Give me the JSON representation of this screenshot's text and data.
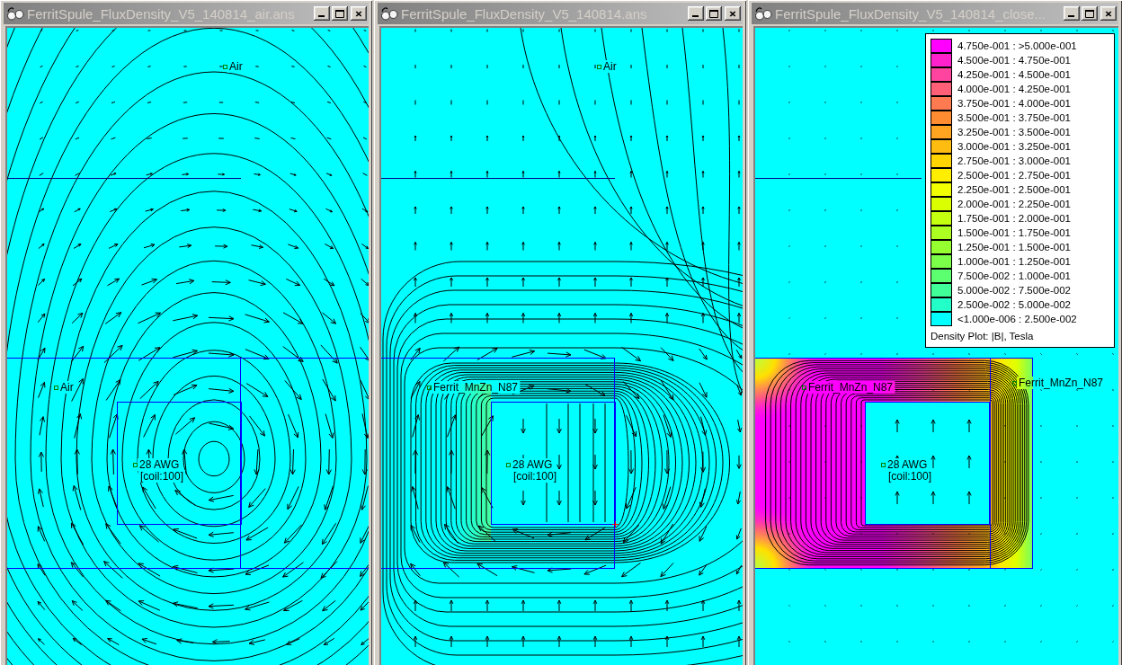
{
  "windows": [
    {
      "title": "FerritSpule_FluxDensity_V5_140814_air.ans",
      "kind": "air",
      "labels": [
        {
          "name": "Air"
        },
        {
          "name": "Air"
        },
        {
          "name": "28 AWG",
          "detail": "[coil:100]"
        }
      ]
    },
    {
      "title": "FerritSpule_FluxDensity_V5_140814.ans",
      "kind": "open",
      "labels": [
        {
          "name": "Air"
        },
        {
          "name": "Ferrit_MnZn_N87"
        },
        {
          "name": "28 AWG",
          "detail": "[coil:100]"
        }
      ]
    },
    {
      "title": "FerritSpule_FluxDensity_V5_140814_close...",
      "kind": "closed",
      "labels": [
        {
          "name": "Ferrit_MnZn_N87"
        },
        {
          "name": "Ferrit_MnZn_N87"
        },
        {
          "name": "28 AWG",
          "detail": "[coil:100]"
        }
      ],
      "legend": {
        "items": [
          {
            "range": "4.750e-001 : >5.000e-001",
            "color": "#ff00ff"
          },
          {
            "range": "4.500e-001 : 4.750e-001",
            "color": "#ff22cc"
          },
          {
            "range": "4.250e-001 : 4.500e-001",
            "color": "#ff44a0"
          },
          {
            "range": "4.000e-001 : 4.250e-001",
            "color": "#ff6078"
          },
          {
            "range": "3.750e-001 : 4.000e-001",
            "color": "#ff7a50"
          },
          {
            "range": "3.500e-001 : 3.750e-001",
            "color": "#ff8c30"
          },
          {
            "range": "3.250e-001 : 3.500e-001",
            "color": "#ffa420"
          },
          {
            "range": "3.000e-001 : 3.250e-001",
            "color": "#ffbc10"
          },
          {
            "range": "2.750e-001 : 3.000e-001",
            "color": "#ffd400"
          },
          {
            "range": "2.500e-001 : 2.750e-001",
            "color": "#ffee00"
          },
          {
            "range": "2.250e-001 : 2.500e-001",
            "color": "#f2ff00"
          },
          {
            "range": "2.000e-001 : 2.250e-001",
            "color": "#daff00"
          },
          {
            "range": "1.750e-001 : 2.000e-001",
            "color": "#c4ff10"
          },
          {
            "range": "1.500e-001 : 1.750e-001",
            "color": "#acff20"
          },
          {
            "range": "1.250e-001 : 1.500e-001",
            "color": "#96ff30"
          },
          {
            "range": "1.000e-001 : 1.250e-001",
            "color": "#7cff48"
          },
          {
            "range": "7.500e-002 : 1.000e-001",
            "color": "#5cff70"
          },
          {
            "range": "5.000e-002 : 7.500e-002",
            "color": "#40ff98"
          },
          {
            "range": "2.500e-002 : 5.000e-002",
            "color": "#22ffc8"
          },
          {
            "range": "<1.000e-006 : 2.500e-002",
            "color": "#00ffff"
          }
        ],
        "caption": "Density Plot: |B|, Tesla"
      }
    }
  ]
}
